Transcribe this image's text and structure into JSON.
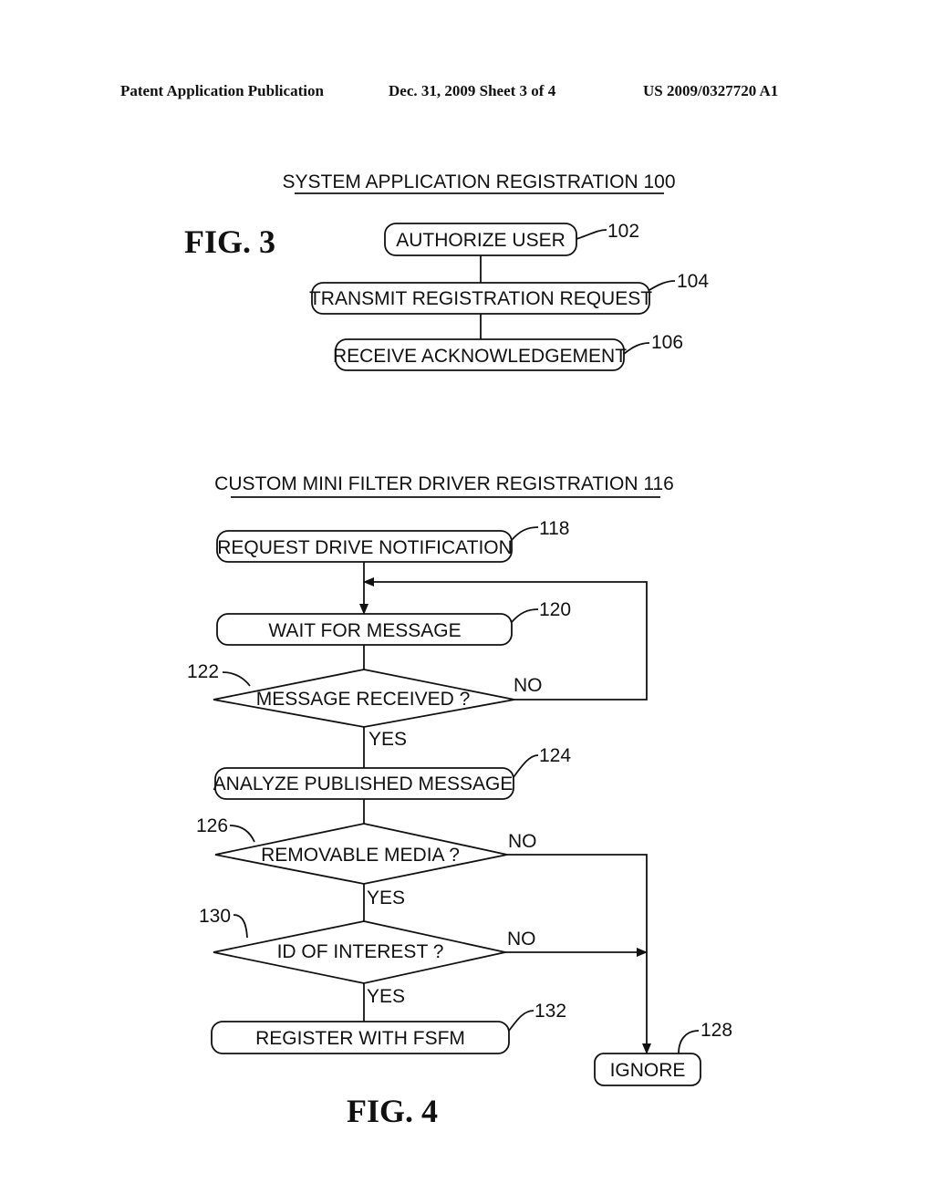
{
  "header": {
    "left": "Patent Application Publication",
    "center": "Dec. 31, 2009   Sheet 3 of 4",
    "right": "US 2009/0327720 A1"
  },
  "fig3": {
    "label": "FIG. 3",
    "title": "SYSTEM APPLICATION REGISTRATION 100",
    "steps": [
      {
        "text": "AUTHORIZE USER",
        "ref": "102"
      },
      {
        "text": "TRANSMIT REGISTRATION REQUEST",
        "ref": "104"
      },
      {
        "text": "RECEIVE ACKNOWLEDGEMENT",
        "ref": "106"
      }
    ]
  },
  "fig4": {
    "label": "FIG. 4",
    "title": "CUSTOM MINI FILTER DRIVER REGISTRATION 116",
    "nodes": {
      "request": {
        "text": "REQUEST DRIVE NOTIFICATION",
        "ref": "118"
      },
      "wait": {
        "text": "WAIT FOR MESSAGE",
        "ref": "120"
      },
      "received": {
        "text": "MESSAGE RECEIVED ?",
        "ref": "122"
      },
      "analyze": {
        "text": "ANALYZE PUBLISHED MESSAGE",
        "ref": "124"
      },
      "removable": {
        "text": "REMOVABLE MEDIA ?",
        "ref": "126"
      },
      "interest": {
        "text": "ID OF INTEREST ?",
        "ref": "130"
      },
      "register": {
        "text": "REGISTER WITH FSFM",
        "ref": "132"
      },
      "ignore": {
        "text": "IGNORE",
        "ref": "128"
      }
    },
    "edge_labels": {
      "yes": "YES",
      "no": "NO"
    }
  }
}
